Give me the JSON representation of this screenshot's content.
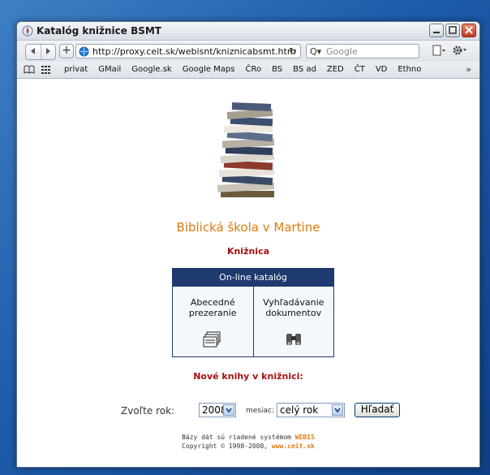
{
  "window": {
    "title": "Katalóg knižnice BSMT"
  },
  "navbar": {
    "add_label": "+",
    "url": "http://proxy.ceit.sk/webisnt/kniznicabsmt.htm",
    "reload_glyph": "↻",
    "search_prefix": "Q▾",
    "search_placeholder": "Google"
  },
  "bookmarks": {
    "items": [
      "privat",
      "GMail",
      "Google.sk",
      "Google Maps",
      "ČRo",
      "BS",
      "BS ad",
      "ZED",
      "ČT",
      "VD",
      "Ethno"
    ],
    "more": "»"
  },
  "page": {
    "site_title": "Biblická škola v Martine",
    "library": "Knižnica",
    "catalog": {
      "header": "On-line katalóg",
      "cell1_line1": "Abecedné",
      "cell1_line2": "prezeranie",
      "cell2_line1": "Vyhľadávanie",
      "cell2_line2": "dokumentov"
    },
    "new_books": "Nové knihy v knižnici:",
    "form": {
      "year_label": "Zvoľte rok:",
      "year_value": "2008",
      "month_label": "mesiac:",
      "month_value": "celý rok",
      "search_button": "Hľadať"
    },
    "footer": {
      "line1_text": "Bázy dát sú riadené systémom ",
      "line1_link": "WEBIS",
      "line2_text": "Copyright © 1998-2008, ",
      "line2_link": "www.ceit.sk"
    }
  },
  "colors": {
    "accent_orange": "#e07a10",
    "accent_red": "#a81010",
    "catalog_navy": "#1e3a6e"
  }
}
